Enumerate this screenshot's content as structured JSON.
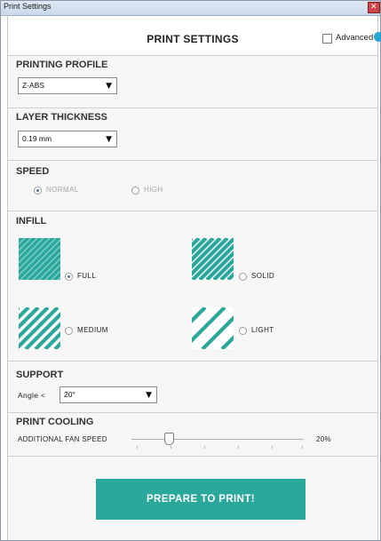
{
  "window": {
    "title": "Print Settings"
  },
  "header": {
    "heading": "PRINT SETTINGS",
    "advanced_label": "Advanced",
    "advanced_checked": false
  },
  "printing_profile": {
    "title": "PRINTING PROFILE",
    "value": "Z-ABS"
  },
  "layer_thickness": {
    "title": "LAYER THICKNESS",
    "value": "0.19 mm"
  },
  "speed": {
    "title": "SPEED",
    "options": [
      {
        "label": "NORMAL",
        "selected": true,
        "enabled": false
      },
      {
        "label": "HIGH",
        "selected": false,
        "enabled": false
      }
    ]
  },
  "infill": {
    "title": "INFILL",
    "options": [
      {
        "label": "FULL",
        "selected": true
      },
      {
        "label": "SOLID",
        "selected": false
      },
      {
        "label": "MEDIUM",
        "selected": false
      },
      {
        "label": "LIGHT",
        "selected": false
      }
    ],
    "accent_color": "#2aa89c"
  },
  "support": {
    "title": "SUPPORT",
    "angle_label": "Angle <",
    "angle_value": "20°"
  },
  "print_cooling": {
    "title": "PRINT COOLING",
    "fan_label": "ADDITIONAL FAN SPEED",
    "fan_value_text": "20%",
    "fan_value": 0.2
  },
  "actions": {
    "prepare_label": "PREPARE TO PRINT!"
  },
  "colors": {
    "accent": "#2aa89c",
    "callout": "#2aa4d0"
  }
}
